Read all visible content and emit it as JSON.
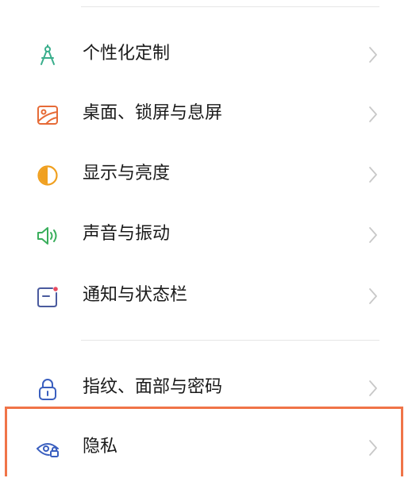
{
  "settings": {
    "items": [
      {
        "label": "个性化定制",
        "icon": "compass-icon",
        "color": "#3aae8c"
      },
      {
        "label": "桌面、锁屏与息屏",
        "icon": "wallpaper-icon",
        "color": "#e66b37"
      },
      {
        "label": "显示与亮度",
        "icon": "brightness-icon",
        "color": "#f0a020"
      },
      {
        "label": "声音与振动",
        "icon": "speaker-icon",
        "color": "#3aae5c"
      },
      {
        "label": "通知与状态栏",
        "icon": "notification-icon",
        "color": "#4a5a9e"
      },
      {
        "label": "指纹、面部与密码",
        "icon": "lock-icon",
        "color": "#3a5fbf"
      },
      {
        "label": "隐私",
        "icon": "privacy-eye-icon",
        "color": "#3a5fbf"
      }
    ]
  },
  "highlight_color": "#f07448"
}
